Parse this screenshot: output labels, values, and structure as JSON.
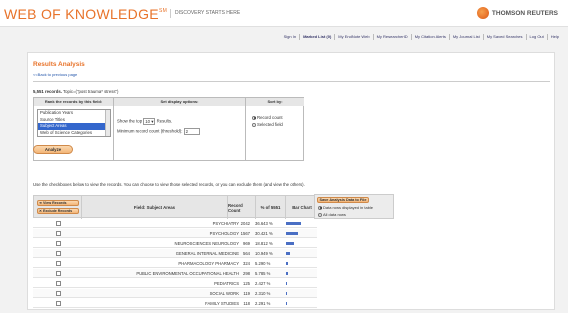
{
  "header": {
    "logo_text": "WEB OF KNOWLEDGE",
    "logo_tm": "SM",
    "tagline": "DISCOVERY STARTS HERE",
    "brand": "THOMSON REUTERS"
  },
  "nav": {
    "items": [
      {
        "label": "Sign In",
        "bold": false
      },
      {
        "label": "Marked List (0)",
        "bold": true
      },
      {
        "label": "My EndNote Web",
        "bold": false
      },
      {
        "label": "My ResearcherID",
        "bold": false
      },
      {
        "label": "My Citation Alerts",
        "bold": false
      },
      {
        "label": "My Journal List",
        "bold": false
      },
      {
        "label": "My Saved Searches",
        "bold": false
      },
      {
        "label": "Log Out",
        "bold": false
      },
      {
        "label": "Help",
        "bold": false
      }
    ]
  },
  "page": {
    "title": "Results Analysis",
    "back_link": "<<Back to previous page",
    "records_count": "5,551 records.",
    "records_query": " Topic=(\"post trauma* stress\")"
  },
  "options": {
    "rank_header": "Rank the records by this field:",
    "display_header": "Set display options:",
    "sort_header": "Sort by:",
    "fields": [
      "Publication Years",
      "Source Titles",
      "Subject Areas",
      "Web of Science Categories"
    ],
    "selected_field_index": 2,
    "show_top_label": "Show the top",
    "show_top_value": "10",
    "results_label": "Results.",
    "min_count_label": "Minimum record count (threshold):",
    "min_count_value": "2",
    "sort_options": [
      "Record count",
      "Selected field"
    ],
    "sort_selected_index": 0,
    "analyze_label": "Analyze"
  },
  "instructions": "Use the checkboxes below to view the records. You can choose to view those selected records, or you can exclude them (and view the others).",
  "save": {
    "button_label": "Save Analysis Data to File",
    "options": [
      "Data rows displayed in table",
      "All data rows"
    ],
    "selected_index": 0
  },
  "table": {
    "view_label": "View Records",
    "exclude_label": "Exclude Records",
    "col_field": "Field: Subject Areas",
    "col_count": "Record Count",
    "col_pct": "% of 5551",
    "col_bar": "Bar Chart",
    "rows": [
      {
        "subject": "PSYCHIATRY",
        "count": "2042",
        "pct": "36.643 %",
        "frac": 0.36643
      },
      {
        "subject": "PSYCHOLOGY",
        "count": "1567",
        "pct": "30.421 %",
        "frac": 0.30421
      },
      {
        "subject": "NEUROSCIENCES NEUROLOGY",
        "count": "969",
        "pct": "18.812 %",
        "frac": 0.18812
      },
      {
        "subject": "GENERAL INTERNAL MEDICINE",
        "count": "564",
        "pct": "10.949 %",
        "frac": 0.10949
      },
      {
        "subject": "PHARMACOLOGY PHARMACY",
        "count": "324",
        "pct": "5.290 %",
        "frac": 0.0529
      },
      {
        "subject": "PUBLIC ENVIRONMENTAL OCCUPATIONAL HEALTH",
        "count": "298",
        "pct": "5.785 %",
        "frac": 0.05785
      },
      {
        "subject": "PEDIATRICS",
        "count": "125",
        "pct": "2.427 %",
        "frac": 0.02427
      },
      {
        "subject": "SOCIAL WORK",
        "count": "119",
        "pct": "2.310 %",
        "frac": 0.0231
      },
      {
        "subject": "FAMILY STUDIES",
        "count": "118",
        "pct": "2.291 %",
        "frac": 0.02291
      }
    ]
  },
  "colors": {
    "accent": "#e8732a",
    "bar": "#4a6fc4",
    "link": "#2255aa"
  }
}
